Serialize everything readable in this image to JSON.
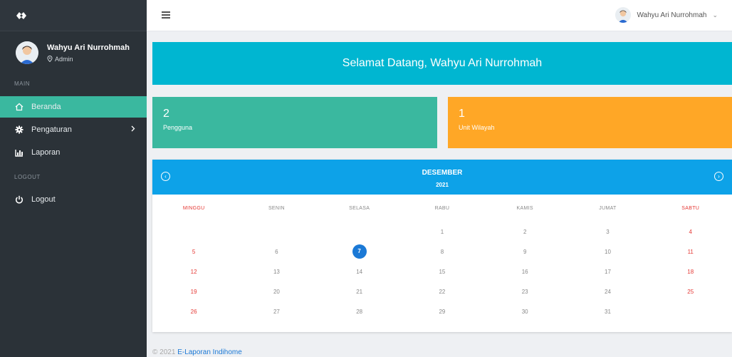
{
  "user": {
    "name": "Wahyu Ari Nurrohmah",
    "role": "Admin"
  },
  "sidebar": {
    "main_label": "MAIN",
    "logout_label": "LOGOUT",
    "items": [
      {
        "label": "Beranda",
        "icon": "home-icon"
      },
      {
        "label": "Pengaturan",
        "icon": "gear-icon"
      },
      {
        "label": "Laporan",
        "icon": "report-icon"
      },
      {
        "label": "Logout",
        "icon": "power-icon"
      }
    ]
  },
  "header": {
    "user_name": "Wahyu Ari Nurrohmah",
    "caret": "⌄"
  },
  "welcome": "Selamat Datang, Wahyu Ari Nurrohmah",
  "stats": [
    {
      "value": "2",
      "label": "Pengguna",
      "color": "#3ab89f"
    },
    {
      "value": "1",
      "label": "Unit Wilayah",
      "color": "#ffa726"
    }
  ],
  "calendar": {
    "month": "DESEMBER",
    "year": "2021",
    "days": [
      "MINGGU",
      "SENIN",
      "SELASA",
      "RABU",
      "KAMIS",
      "JUMAT",
      "SABTU"
    ],
    "weeks": [
      [
        "",
        "",
        "",
        "1",
        "2",
        "3",
        "4"
      ],
      [
        "5",
        "6",
        "7",
        "8",
        "9",
        "10",
        "11"
      ],
      [
        "12",
        "13",
        "14",
        "15",
        "16",
        "17",
        "18"
      ],
      [
        "19",
        "20",
        "21",
        "22",
        "23",
        "24",
        "25"
      ],
      [
        "26",
        "27",
        "28",
        "29",
        "30",
        "31",
        ""
      ]
    ],
    "today": "7",
    "accent": "#0da2e8"
  },
  "footer": {
    "prefix": "© 2021",
    "link": "E-Laporan Indihome"
  }
}
